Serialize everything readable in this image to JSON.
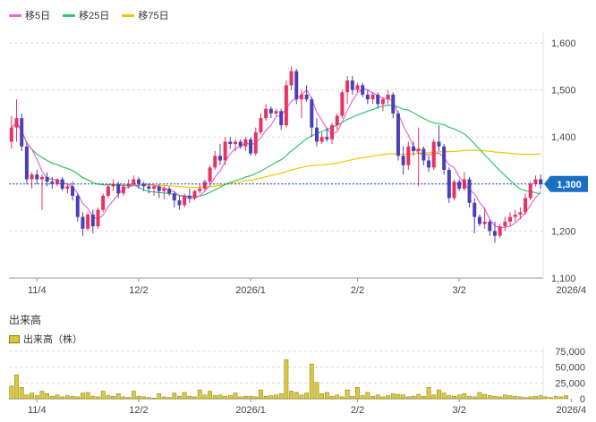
{
  "legend": {
    "ma5": "移5日",
    "ma25": "移25日",
    "ma75": "移75日"
  },
  "volume_panel": {
    "title": "出来高",
    "legend": "出来高（株）"
  },
  "colors": {
    "up": "#e8325f",
    "down": "#4b3fb5",
    "ma5": "#e46bd6",
    "ma25": "#2fc86e",
    "ma75": "#f2c500",
    "volume_fill": "#d9c941",
    "volume_stroke": "#8a7a00",
    "current_price_bg": "#1b6fc2",
    "current_price_line": "#1f4fa8"
  },
  "chart_data": {
    "type": "candlestick",
    "price_axis": {
      "ticks": [
        1100,
        1200,
        1300,
        1400,
        1500,
        1600
      ],
      "tick_labels": [
        "1,100",
        "1,200",
        "1,300",
        "1,400",
        "1,500",
        "1,600"
      ],
      "range": [
        1100,
        1600
      ]
    },
    "volume_axis": {
      "ticks": [
        0,
        25000,
        50000,
        75000
      ],
      "tick_labels": [
        "0",
        "25,000",
        "50,000",
        "75,000"
      ],
      "range": [
        0,
        75000
      ]
    },
    "x_axis": {
      "labels": [
        "11/4",
        "12/2",
        "2026/1",
        "2/2",
        "3/2",
        "2026/4"
      ],
      "label_index": [
        5,
        25,
        47,
        68,
        88,
        110
      ]
    },
    "current_price": {
      "value": 1300,
      "label": "1,300"
    },
    "candles": [
      [
        1390,
        1445,
        1375,
        1420
      ],
      [
        1420,
        1480,
        1390,
        1440
      ],
      [
        1440,
        1450,
        1370,
        1380
      ],
      [
        1380,
        1390,
        1300,
        1310
      ],
      [
        1310,
        1325,
        1290,
        1320
      ],
      [
        1320,
        1330,
        1300,
        1310
      ],
      [
        1310,
        1320,
        1245,
        1315
      ],
      [
        1315,
        1325,
        1295,
        1305
      ],
      [
        1305,
        1315,
        1290,
        1300
      ],
      [
        1300,
        1312,
        1295,
        1310
      ],
      [
        1310,
        1315,
        1285,
        1290
      ],
      [
        1290,
        1300,
        1280,
        1295
      ],
      [
        1295,
        1305,
        1265,
        1275
      ],
      [
        1275,
        1280,
        1220,
        1230
      ],
      [
        1230,
        1240,
        1190,
        1205
      ],
      [
        1205,
        1240,
        1200,
        1235
      ],
      [
        1235,
        1245,
        1195,
        1210
      ],
      [
        1210,
        1250,
        1205,
        1245
      ],
      [
        1245,
        1280,
        1240,
        1275
      ],
      [
        1275,
        1300,
        1270,
        1295
      ],
      [
        1295,
        1310,
        1285,
        1300
      ],
      [
        1300,
        1305,
        1270,
        1280
      ],
      [
        1280,
        1300,
        1275,
        1295
      ],
      [
        1295,
        1310,
        1290,
        1300
      ],
      [
        1300,
        1318,
        1295,
        1310
      ],
      [
        1310,
        1315,
        1290,
        1300
      ],
      [
        1300,
        1305,
        1285,
        1295
      ],
      [
        1295,
        1302,
        1280,
        1290
      ],
      [
        1290,
        1298,
        1275,
        1295
      ],
      [
        1295,
        1300,
        1270,
        1285
      ],
      [
        1285,
        1295,
        1268,
        1290
      ],
      [
        1290,
        1295,
        1275,
        1280
      ],
      [
        1280,
        1285,
        1250,
        1265
      ],
      [
        1265,
        1275,
        1245,
        1255
      ],
      [
        1255,
        1280,
        1250,
        1275
      ],
      [
        1275,
        1290,
        1260,
        1270
      ],
      [
        1270,
        1288,
        1265,
        1285
      ],
      [
        1285,
        1300,
        1280,
        1290
      ],
      [
        1290,
        1310,
        1285,
        1305
      ],
      [
        1305,
        1340,
        1300,
        1335
      ],
      [
        1335,
        1370,
        1330,
        1360
      ],
      [
        1360,
        1385,
        1340,
        1350
      ],
      [
        1350,
        1400,
        1340,
        1390
      ],
      [
        1390,
        1400,
        1375,
        1385
      ],
      [
        1385,
        1395,
        1370,
        1390
      ],
      [
        1390,
        1395,
        1375,
        1380
      ],
      [
        1380,
        1400,
        1370,
        1395
      ],
      [
        1395,
        1400,
        1360,
        1365
      ],
      [
        1365,
        1420,
        1360,
        1410
      ],
      [
        1410,
        1450,
        1405,
        1440
      ],
      [
        1440,
        1470,
        1435,
        1460
      ],
      [
        1460,
        1465,
        1440,
        1450
      ],
      [
        1450,
        1460,
        1445,
        1455
      ],
      [
        1455,
        1460,
        1415,
        1425
      ],
      [
        1425,
        1520,
        1420,
        1510
      ],
      [
        1510,
        1550,
        1500,
        1540
      ],
      [
        1540,
        1545,
        1470,
        1480
      ],
      [
        1480,
        1500,
        1440,
        1490
      ],
      [
        1490,
        1510,
        1475,
        1480
      ],
      [
        1480,
        1485,
        1400,
        1420
      ],
      [
        1420,
        1440,
        1380,
        1390
      ],
      [
        1390,
        1410,
        1385,
        1400
      ],
      [
        1400,
        1420,
        1390,
        1395
      ],
      [
        1395,
        1430,
        1385,
        1425
      ],
      [
        1425,
        1450,
        1415,
        1445
      ],
      [
        1445,
        1500,
        1440,
        1495
      ],
      [
        1495,
        1530,
        1470,
        1520
      ],
      [
        1520,
        1530,
        1490,
        1500
      ],
      [
        1500,
        1515,
        1495,
        1510
      ],
      [
        1510,
        1515,
        1485,
        1490
      ],
      [
        1490,
        1500,
        1470,
        1480
      ],
      [
        1480,
        1495,
        1470,
        1490
      ],
      [
        1490,
        1495,
        1460,
        1470
      ],
      [
        1470,
        1485,
        1455,
        1480
      ],
      [
        1480,
        1500,
        1470,
        1490
      ],
      [
        1490,
        1495,
        1440,
        1450
      ],
      [
        1450,
        1455,
        1350,
        1360
      ],
      [
        1360,
        1380,
        1320,
        1340
      ],
      [
        1340,
        1390,
        1330,
        1380
      ],
      [
        1380,
        1390,
        1360,
        1370
      ],
      [
        1370,
        1420,
        1295,
        1375
      ],
      [
        1375,
        1380,
        1340,
        1350
      ],
      [
        1350,
        1360,
        1325,
        1335
      ],
      [
        1335,
        1395,
        1330,
        1390
      ],
      [
        1390,
        1425,
        1370,
        1380
      ],
      [
        1380,
        1385,
        1320,
        1330
      ],
      [
        1330,
        1335,
        1260,
        1270
      ],
      [
        1270,
        1310,
        1265,
        1305
      ],
      [
        1305,
        1310,
        1285,
        1290
      ],
      [
        1290,
        1325,
        1285,
        1310
      ],
      [
        1310,
        1315,
        1250,
        1260
      ],
      [
        1260,
        1270,
        1195,
        1230
      ],
      [
        1230,
        1235,
        1210,
        1215
      ],
      [
        1215,
        1250,
        1205,
        1220
      ],
      [
        1220,
        1225,
        1190,
        1200
      ],
      [
        1200,
        1220,
        1175,
        1190
      ],
      [
        1190,
        1215,
        1185,
        1210
      ],
      [
        1210,
        1230,
        1200,
        1220
      ],
      [
        1220,
        1240,
        1210,
        1230
      ],
      [
        1230,
        1245,
        1220,
        1235
      ],
      [
        1235,
        1250,
        1225,
        1240
      ],
      [
        1240,
        1280,
        1235,
        1270
      ],
      [
        1270,
        1305,
        1265,
        1300
      ],
      [
        1300,
        1318,
        1295,
        1310
      ],
      [
        1310,
        1320,
        1290,
        1300
      ]
    ],
    "volume": [
      20000,
      38000,
      18000,
      6000,
      9000,
      5000,
      12000,
      8000,
      4000,
      6000,
      3000,
      5000,
      4000,
      3000,
      9000,
      10000,
      4000,
      3000,
      12000,
      5000,
      4000,
      8000,
      3000,
      2000,
      12000,
      4000,
      3000,
      2000,
      1000,
      8000,
      3000,
      2000,
      9000,
      4000,
      10000,
      4000,
      3000,
      14000,
      6000,
      12000,
      5000,
      6000,
      4000,
      5000,
      9000,
      3000,
      4000,
      4000,
      3000,
      14000,
      4000,
      5000,
      6000,
      8000,
      62000,
      12000,
      10000,
      6000,
      9000,
      55000,
      26000,
      8000,
      10000,
      4000,
      6000,
      3000,
      14000,
      4000,
      18000,
      5000,
      10000,
      4000,
      6000,
      3000,
      5000,
      8000,
      7000,
      6000,
      3000,
      4000,
      7000,
      4000,
      18000,
      6000,
      14000,
      9000,
      5000,
      4000,
      6000,
      8000,
      4000,
      3000,
      10000,
      7000,
      5000,
      4000,
      3000,
      6000,
      5000,
      4000,
      3000,
      2000,
      3000,
      4000,
      5000,
      3000,
      2000,
      4000,
      3000,
      5000
    ]
  }
}
